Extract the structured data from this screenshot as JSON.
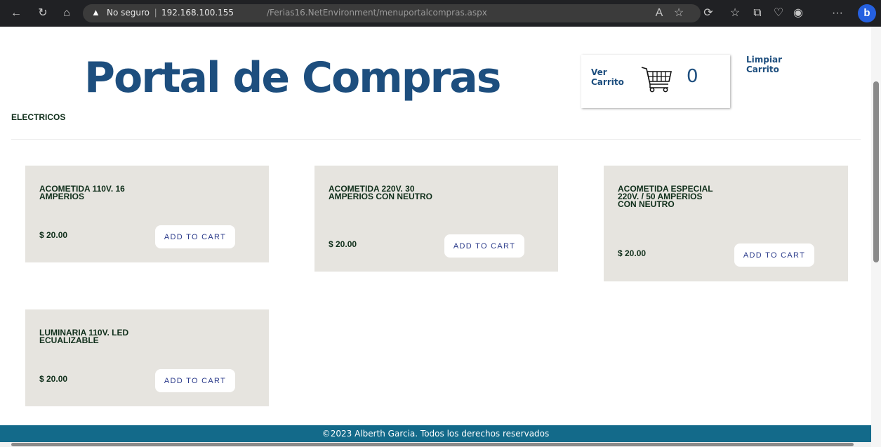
{
  "browser": {
    "security_label": "No seguro",
    "url_host": "192.168.100.155",
    "url_path": "/Ferias16.NetEnvironment/menuportalcompras.aspx"
  },
  "header": {
    "title": "Portal de Compras",
    "view_cart_label": "Ver Carrito",
    "cart_count": "0",
    "clear_cart_label": "Limpiar Carrito"
  },
  "category": "ELECTRICOS",
  "products": [
    {
      "name": "ACOMETIDA 110V. 16 AMPERIOS",
      "price": "$ 20.00",
      "button": "ADD TO CART"
    },
    {
      "name": "ACOMETIDA 220V. 30 AMPERIOS CON NEUTRO",
      "price": "$ 20.00",
      "button": "ADD TO CART"
    },
    {
      "name": "ACOMETIDA ESPECIAL 220V. / 50 AMPERIOS CON NEUTRO",
      "price": "$ 20.00",
      "button": "ADD TO CART"
    },
    {
      "name": "LUMINARIA 110V. LED ECUALIZABLE",
      "price": "$ 20.00",
      "button": "ADD TO CART"
    }
  ],
  "footer": "©2023 Alberth Garcia. Todos los derechos reservados"
}
